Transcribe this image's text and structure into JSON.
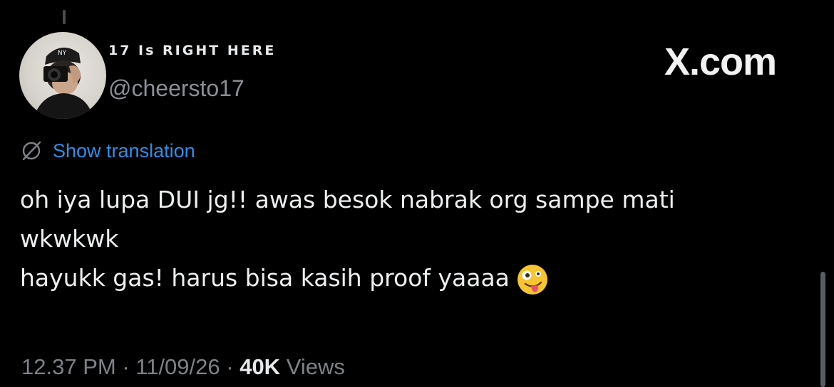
{
  "header": {
    "display_name": "17 Is RIGHT HERE",
    "handle": "@cheersto17",
    "brand": "X.com"
  },
  "translation": {
    "link_label": "Show translation",
    "icon": "globe-slash-icon"
  },
  "tweet": {
    "lines": [
      "oh iya lupa DUI jg!! awas besok nabrak org sampe mati",
      "wkwkwk",
      "hayukk gas! harus bisa kasih proof yaaaa"
    ],
    "emoji": "zany-face-emoji"
  },
  "meta": {
    "time": "12.37 PM",
    "separator": " · ",
    "date": "11/09/26",
    "views_count": "40K",
    "views_label": "Views"
  },
  "colors": {
    "background": "#000000",
    "link": "#2f8fe6",
    "muted": "#7d8287",
    "text": "#e7e9ea"
  }
}
